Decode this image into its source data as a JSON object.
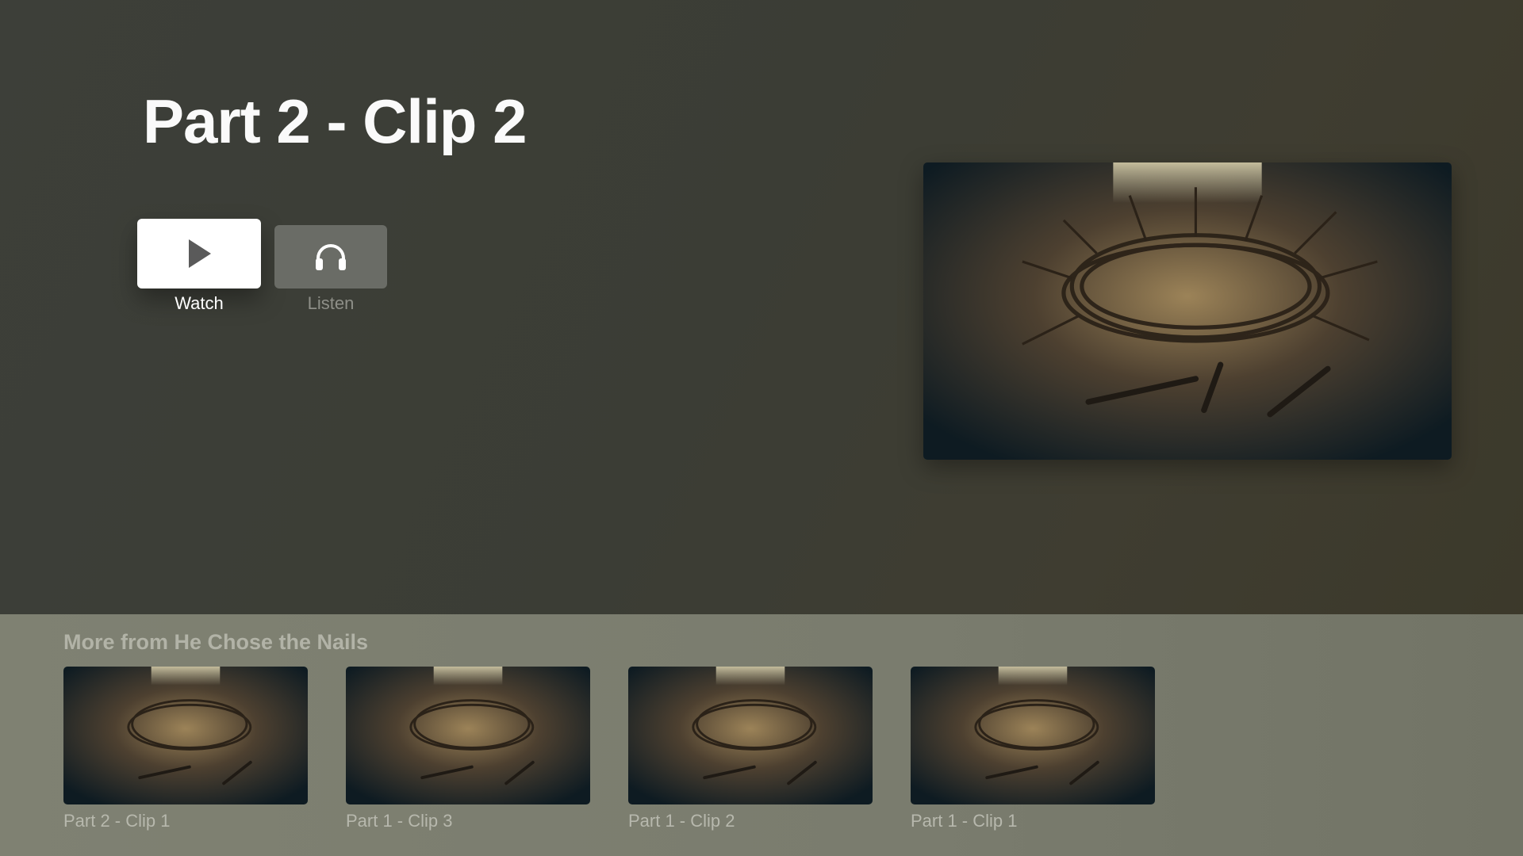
{
  "header": {
    "title": "Part 2 - Clip 2"
  },
  "actions": [
    {
      "label": "Watch",
      "icon": "play-icon"
    },
    {
      "label": "Listen",
      "icon": "headphones-icon"
    }
  ],
  "hero": {
    "artwork": "crown-of-thorns-with-nails"
  },
  "shelf": {
    "title": "More from He Chose the Nails",
    "items": [
      {
        "label": "Part 2 - Clip 1"
      },
      {
        "label": "Part 1 - Clip 3"
      },
      {
        "label": "Part 1 - Clip 2"
      },
      {
        "label": "Part 1 - Clip 1"
      }
    ]
  },
  "colors": {
    "background": "#3d3f38",
    "shelf": "#7d7f70",
    "button_focus": "#ffffff",
    "button_idle": "#6a6c66"
  }
}
